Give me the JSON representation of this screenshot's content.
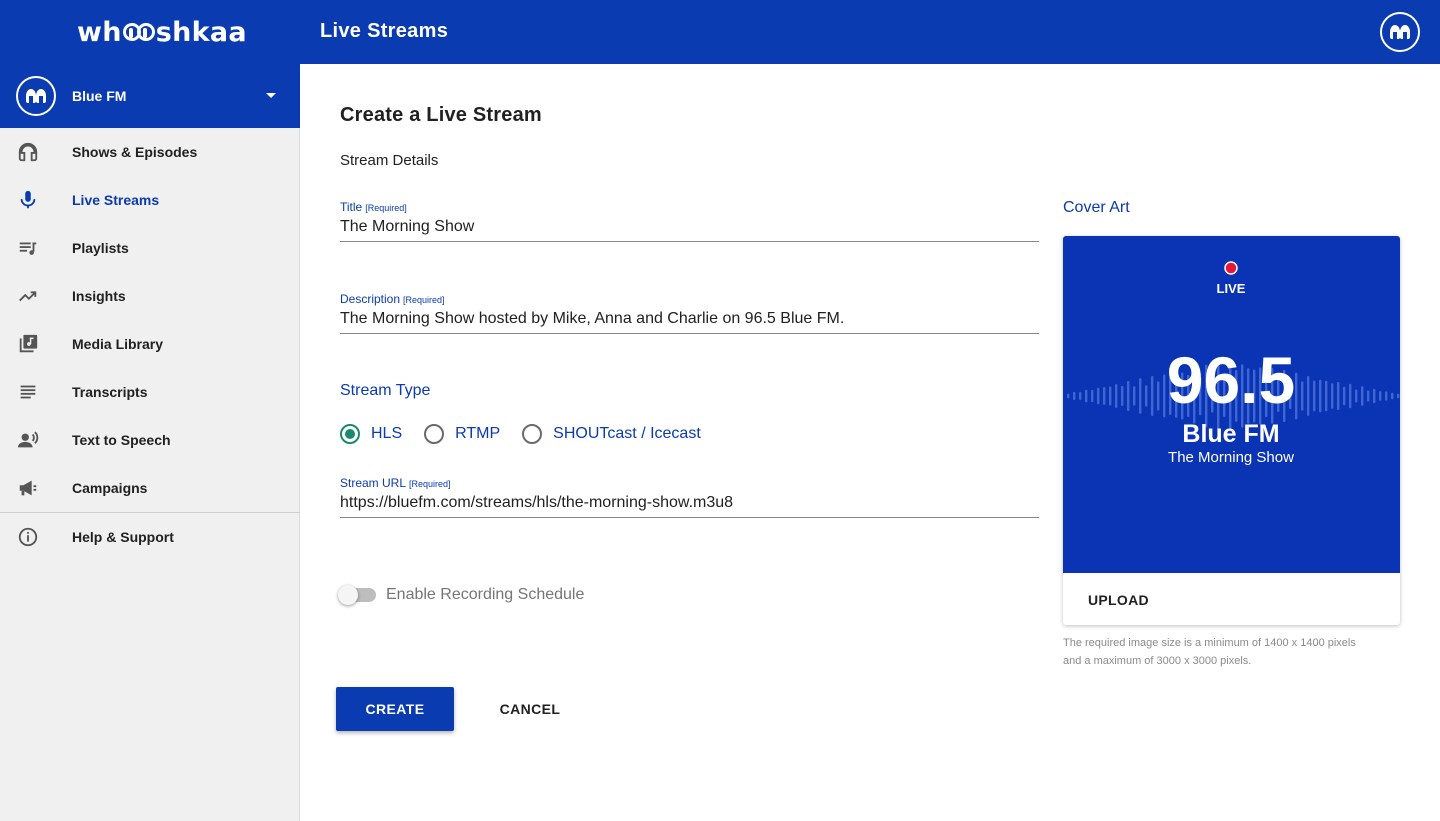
{
  "app": {
    "logo_text_left": "wh",
    "logo_text_right": "shkaa",
    "page_title": "Live Streams"
  },
  "sidebar": {
    "station_name": "Blue FM",
    "items": [
      {
        "label": "Shows & Episodes",
        "icon": "headphones-icon"
      },
      {
        "label": "Live Streams",
        "icon": "microphone-icon",
        "active": true
      },
      {
        "label": "Playlists",
        "icon": "playlist-icon"
      },
      {
        "label": "Insights",
        "icon": "trending-up-icon"
      },
      {
        "label": "Media Library",
        "icon": "library-music-icon"
      },
      {
        "label": "Transcripts",
        "icon": "subject-lines-icon"
      },
      {
        "label": "Text to Speech",
        "icon": "voice-person-icon"
      },
      {
        "label": "Campaigns",
        "icon": "megaphone-icon"
      }
    ],
    "help": {
      "label": "Help & Support",
      "icon": "info-icon"
    }
  },
  "form": {
    "heading": "Create a Live Stream",
    "section": "Stream Details",
    "title_label": "Title",
    "title_required": "[Required]",
    "title_value": "The Morning Show",
    "description_label": "Description",
    "description_required": "[Required]",
    "description_value": "The Morning Show hosted by Mike, Anna and Charlie on 96.5 Blue FM.",
    "stream_type_label": "Stream Type",
    "stream_types": [
      "HLS",
      "RTMP",
      "SHOUTcast / Icecast"
    ],
    "stream_type_selected": "HLS",
    "url_label": "Stream URL",
    "url_required": "[Required]",
    "url_value": "https://bluefm.com/streams/hls/the-morning-show.m3u8",
    "recording_label": "Enable Recording Schedule",
    "recording_enabled": false,
    "create_label": "CREATE",
    "cancel_label": "CANCEL"
  },
  "cover": {
    "label": "Cover Art",
    "art_live": "LIVE",
    "art_frequency": "96.5",
    "art_station": "Blue FM",
    "art_show": "The Morning Show",
    "upload_label": "UPLOAD",
    "hint_line1": "The required image size is a minimum of 1400 x 1400 pixels",
    "hint_line2": "and a maximum of 3000 x 3000 pixels."
  },
  "colors": {
    "brand_blue": "#0a3bb0",
    "radio_selected": "#1a8a6e",
    "live_dot": "#e8173a"
  }
}
